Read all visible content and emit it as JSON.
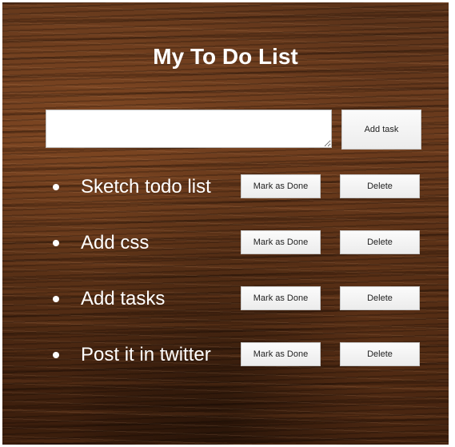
{
  "header": {
    "title": "My To Do List"
  },
  "form": {
    "input_value": "",
    "add_label": "Add task"
  },
  "tasks": [
    {
      "text": "Sketch todo list",
      "done_label": "Mark as Done",
      "delete_label": "Delete"
    },
    {
      "text": "Add css",
      "done_label": "Mark as Done",
      "delete_label": "Delete"
    },
    {
      "text": "Add tasks",
      "done_label": "Mark as Done",
      "delete_label": "Delete"
    },
    {
      "text": "Post it in twitter",
      "done_label": "Mark as Done",
      "delete_label": "Delete"
    }
  ],
  "colors": {
    "text": "#ffffff",
    "wood_dark": "#3a1d0c",
    "wood_light": "#6b3b1d",
    "button_bg": "#f2f2f2"
  }
}
